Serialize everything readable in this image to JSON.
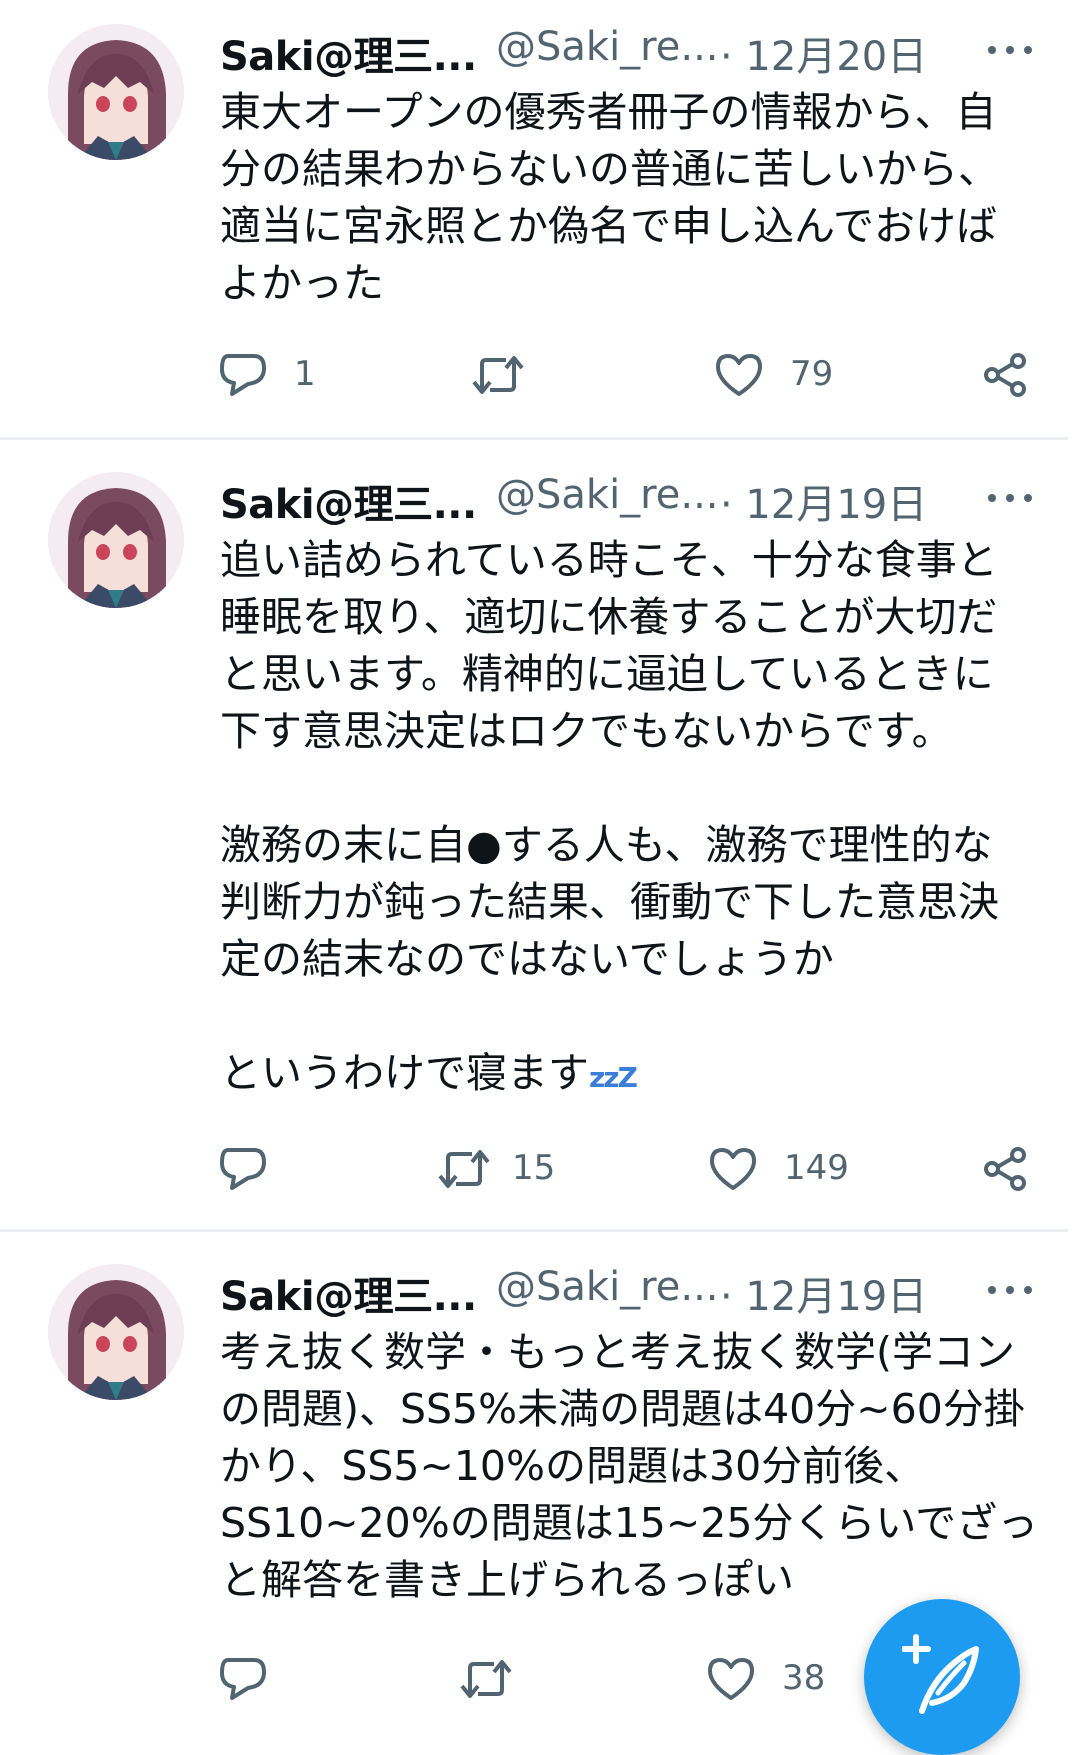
{
  "tweets": [
    {
      "name": "Saki@理三...",
      "handle": "@Saki_re...",
      "date": "· 12月20日",
      "lines": [
        "東大オープンの優秀者冊子の情報から、自",
        "分の結果わからないの普通に苦しいから、",
        "適当に宮永照とか偽名で申し込んでおけば",
        "よかった"
      ],
      "replies": "1",
      "retweets": "",
      "likes": "79"
    },
    {
      "name": "Saki@理三...",
      "handle": "@Saki_re...",
      "date": "· 12月19日",
      "lines": [
        "追い詰められている時こそ、十分な食事と",
        "睡眠を取り、適切に休養することが大切だ",
        "と思います。精神的に逼迫しているときに",
        "下す意思決定はロクでもないからです。",
        "",
        "激務の末に自●する人も、激務で理性的な",
        "判断力が鈍った結果、衝動で下した意思決",
        "定の結末なのではないでしょうか",
        "",
        "というわけで寝ます"
      ],
      "emoji": "zzZ",
      "replies": "",
      "retweets": "15",
      "likes": "149"
    },
    {
      "name": "Saki@理三...",
      "handle": "@Saki_re...",
      "date": "· 12月19日",
      "lines": [
        "考え抜く数学・もっと考え抜く数学(学コン",
        "の問題)、SS5%未満の問題は40分~60分掛",
        "かり、SS5~10%の問題は30分前後、",
        "SS10~20%の問題は15~25分くらいでざっ",
        "と解答を書き上げられるっぽい"
      ],
      "replies": "",
      "retweets": "",
      "likes": "38"
    }
  ],
  "icons": {
    "reply": "reply-icon",
    "retweet": "retweet-icon",
    "like": "like-icon",
    "share": "share-icon",
    "more": "more-icon",
    "compose": "compose-tweet-icon"
  },
  "colors": {
    "text": "#0f1419",
    "secondary": "#536471",
    "accent": "#1d9bf0",
    "divider": "#eceff1"
  }
}
